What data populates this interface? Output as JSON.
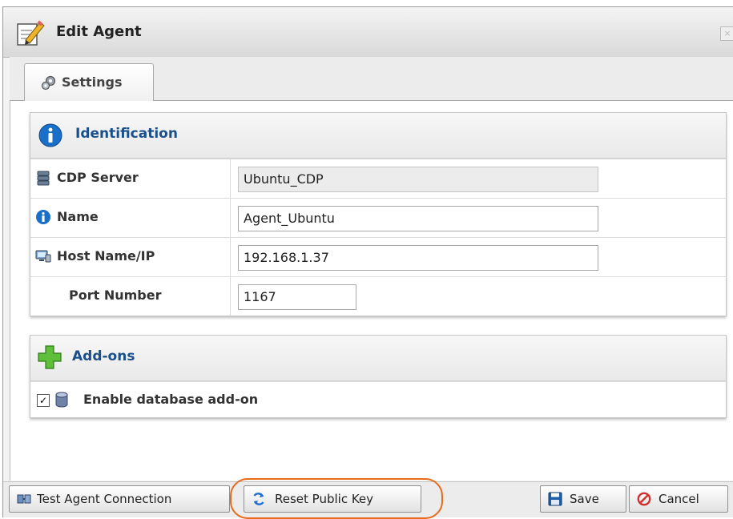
{
  "window": {
    "title": "Edit Agent",
    "close_glyph": "×"
  },
  "tabs": [
    {
      "label": "Settings",
      "icon": "gears-icon",
      "active": true
    }
  ],
  "identification": {
    "title": "Identification",
    "fields": {
      "cdp_server": {
        "label": "CDP Server",
        "value": "Ubuntu_CDP",
        "readonly": true
      },
      "name": {
        "label": "Name",
        "value": "Agent_Ubuntu"
      },
      "host": {
        "label": "Host Name/IP",
        "value": "192.168.1.37"
      },
      "port": {
        "label": "Port Number",
        "value": "1167"
      }
    }
  },
  "addons": {
    "title": "Add-ons",
    "enable_db": {
      "label": "Enable database add-on",
      "checked": true,
      "check_glyph": "✓"
    }
  },
  "footer": {
    "test_connection": "Test Agent Connection",
    "reset_key": "Reset Public Key",
    "save": "Save",
    "cancel": "Cancel"
  },
  "colors": {
    "panel_title": "#1b4f8a",
    "highlight": "#e86a1c",
    "cancel_icon": "#d32f2f",
    "save_icon": "#1e5fa8"
  }
}
